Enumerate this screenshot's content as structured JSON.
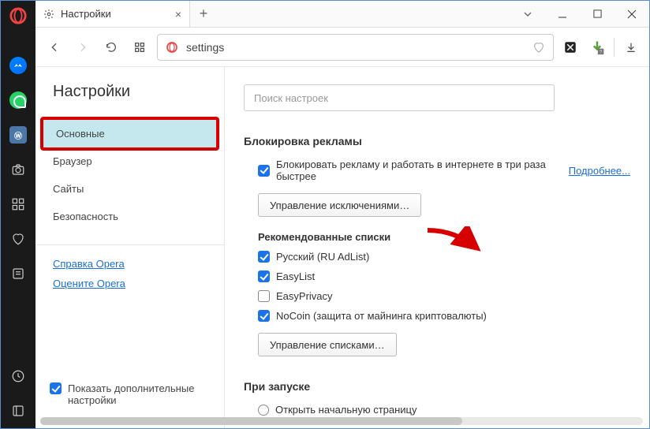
{
  "leftbar": {
    "vk_label": "Ⓦ"
  },
  "tab": {
    "title": "Настройки"
  },
  "url": "settings",
  "sidebar": {
    "title": "Настройки",
    "items": [
      "Основные",
      "Браузер",
      "Сайты",
      "Безопасность"
    ],
    "links": [
      "Справка Opera",
      "Оцените Opera"
    ],
    "footer_label": "Показать дополнительные настройки"
  },
  "search_placeholder": "Поиск настроек",
  "adblock": {
    "heading": "Блокировка рекламы",
    "main_label": "Блокировать рекламу и работать в интернете в три раза быстрее",
    "learn_more": "Подробнее...",
    "exceptions_btn": "Управление исключениями…",
    "lists_heading": "Рекомендованные списки",
    "lists": [
      {
        "label": "Русский (RU AdList)",
        "checked": true
      },
      {
        "label": "EasyList",
        "checked": true
      },
      {
        "label": "EasyPrivacy",
        "checked": false
      },
      {
        "label": "NoCoin (защита от майнинга криптовалюты)",
        "checked": true
      }
    ],
    "manage_lists_btn": "Управление списками…"
  },
  "startup": {
    "heading": "При запуске",
    "options": [
      "Открыть начальную страницу"
    ]
  }
}
